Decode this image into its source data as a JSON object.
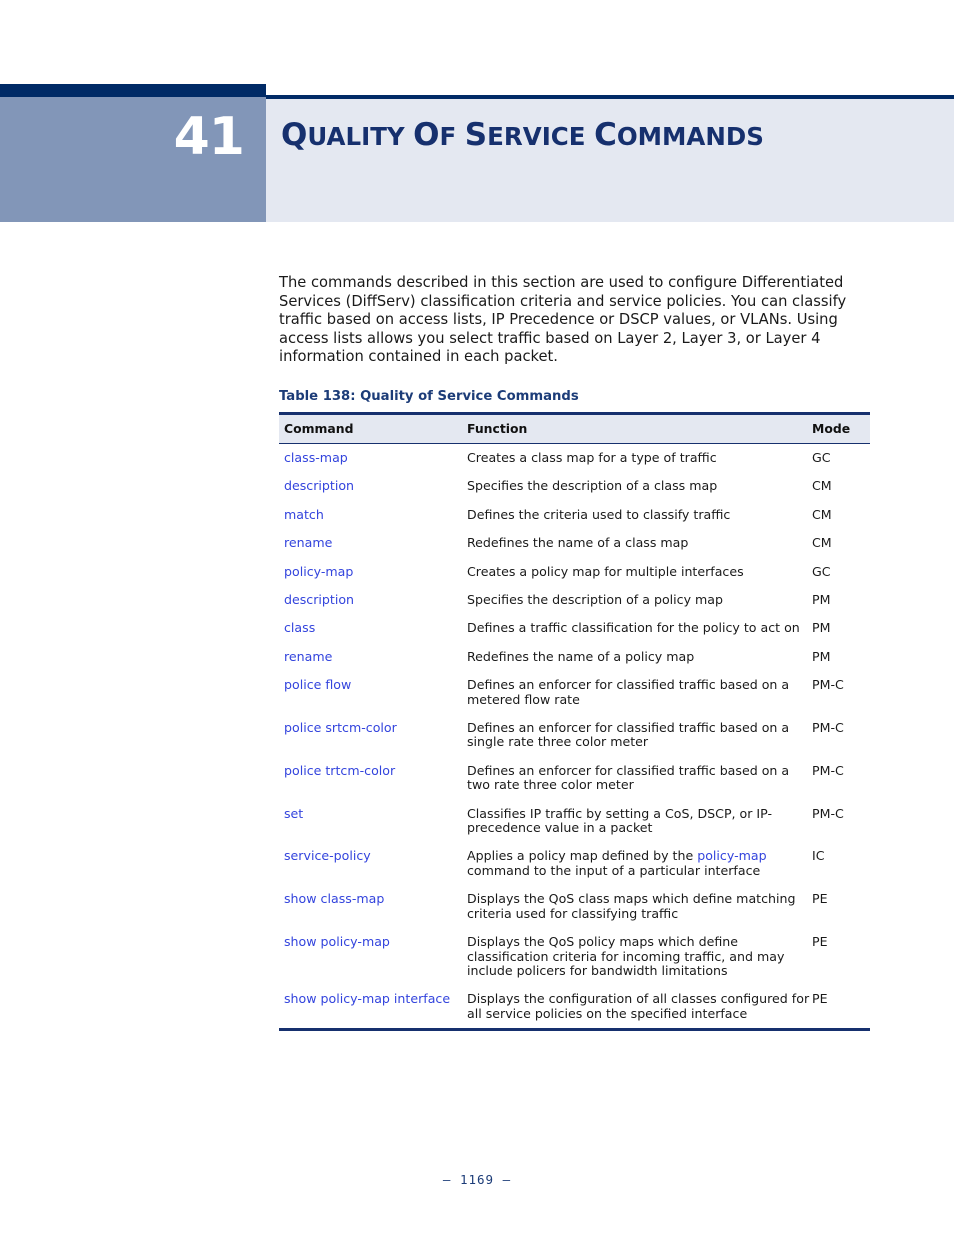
{
  "banner": {
    "chapter_number": "41",
    "title_words": [
      {
        "cap": "Q",
        "rest": "UALITY"
      },
      {
        "cap": "O",
        "rest": "F"
      },
      {
        "cap": "S",
        "rest": "ERVICE"
      },
      {
        "cap": "C",
        "rest": "OMMANDS"
      }
    ],
    "title_plain": "Quality of Service Commands",
    "colors": {
      "navy_rule": "#002a66",
      "number_block": "#8296b8",
      "title_band": "#e4e8f1",
      "title_text": "#16306e"
    }
  },
  "intro": {
    "paragraph": "The commands described in this section are used to configure Differentiated Services (DiffServ) classification criteria and service policies. You can classify traffic based on access lists, IP Precedence or DSCP values, or VLANs. Using access lists allows you select traffic based on Layer 2, Layer 3, or Layer 4 information contained in each packet."
  },
  "table": {
    "caption": "Table 138: Quality of Service Commands",
    "headers": [
      "Command",
      "Function",
      "Mode"
    ],
    "link_color": "#3344dd",
    "rows": [
      {
        "command": "class-map",
        "function": "Creates a class map for a type of traffic",
        "mode": "GC"
      },
      {
        "command": "description",
        "function": "Specifies the description of a class map",
        "mode": "CM"
      },
      {
        "command": "match",
        "function": "Defines the criteria used to classify traffic",
        "mode": "CM"
      },
      {
        "command": "rename",
        "function": "Redefines the name of a class map",
        "mode": "CM"
      },
      {
        "command": "policy-map",
        "function": "Creates a policy map for multiple interfaces",
        "mode": "GC"
      },
      {
        "command": "description",
        "function": "Specifies the description of a policy map",
        "mode": "PM"
      },
      {
        "command": "class",
        "function": "Defines a traffic classification for the policy to act on",
        "mode": "PM"
      },
      {
        "command": "rename",
        "function": "Redefines the name of a policy map",
        "mode": "PM"
      },
      {
        "command": "police flow",
        "function": "Defines an enforcer for classified traffic based on a metered flow rate",
        "mode": "PM-C"
      },
      {
        "command": "police srtcm-color",
        "function": "Defines an enforcer for classified traffic based on a single rate three color meter",
        "mode": "PM-C"
      },
      {
        "command": "police trtcm-color",
        "function": "Defines an enforcer for classified traffic based on a two rate three color meter",
        "mode": "PM-C"
      },
      {
        "command": "set",
        "function": "Classifies IP traffic by setting a CoS, DSCP, or IP-precedence value in a packet",
        "mode": "PM-C"
      },
      {
        "command": "service-policy",
        "function_pre": "Applies a policy map defined by the ",
        "function_link": "policy-map",
        "function_post": " command to the input of a particular interface",
        "mode": "IC"
      },
      {
        "command": "show class-map",
        "function": "Displays the QoS class maps which define matching criteria used for classifying traffic",
        "mode": "PE"
      },
      {
        "command": "show policy-map",
        "function": "Displays the QoS policy maps which define classification criteria for incoming traffic, and may include policers for bandwidth limitations",
        "mode": "PE"
      },
      {
        "command": "show policy-map interface",
        "function": "Displays the configuration of all classes configured for all service policies on the specified interface",
        "mode": "PE"
      }
    ]
  },
  "footer": {
    "page_label": "–  1169  –"
  }
}
